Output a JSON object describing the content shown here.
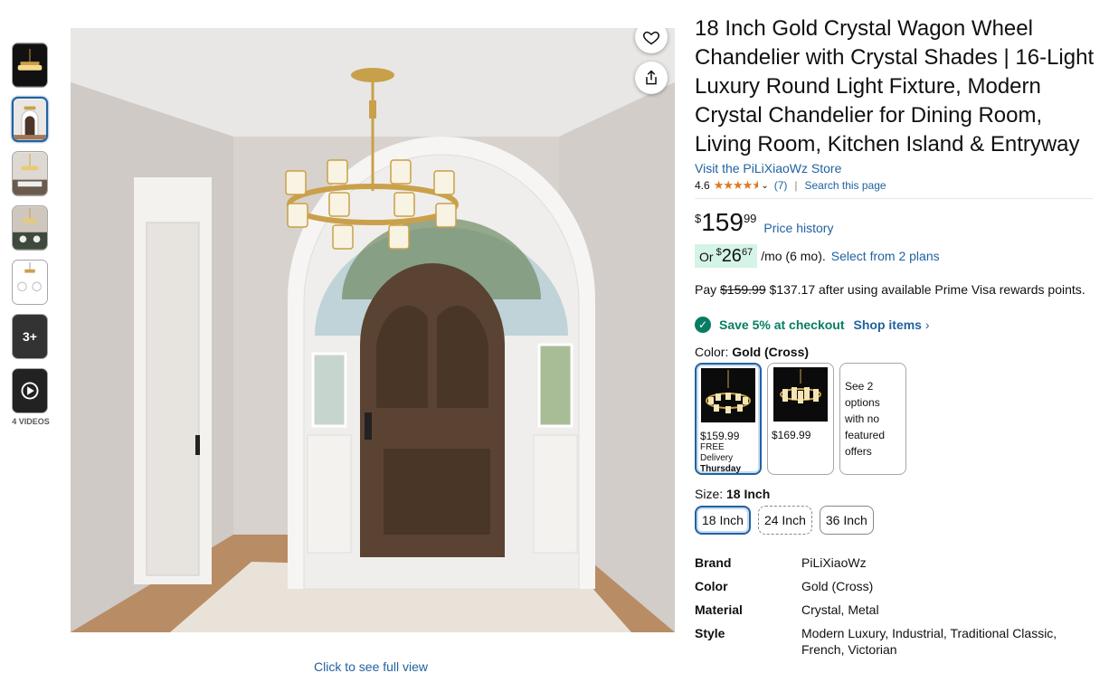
{
  "thumbnails": [
    {
      "name": "thumb-1",
      "selected": false
    },
    {
      "name": "thumb-2",
      "selected": true
    },
    {
      "name": "thumb-3",
      "selected": false
    },
    {
      "name": "thumb-4",
      "selected": false
    },
    {
      "name": "thumb-5",
      "selected": false
    }
  ],
  "more_thumbs_label": "3+",
  "videos_label": "4 VIDEOS",
  "main_image": {
    "icons": [
      "heart-icon",
      "share-icon"
    ],
    "full_view_label": "Click to see full view"
  },
  "product": {
    "title": "18 Inch Gold Crystal Wagon Wheel Chandelier with Crystal Shades | 16-Light Luxury Round Light Fixture, Modern Crystal Chandelier for Dining Room, Living Room, Kitchen Island & Entryway",
    "store_link": "Visit the PiLiXiaoWz Store",
    "rating": "4.6",
    "rating_count": "(7)",
    "search_page": "Search this page",
    "price": {
      "symbol": "$",
      "whole": "159",
      "fraction": "99"
    },
    "price_history": "Price history",
    "monthly": {
      "or": "Or",
      "symbol": "$",
      "whole": "26",
      "fraction": "67",
      "per": "/mo (6 mo).",
      "plans": "Select from 2 plans"
    },
    "pay": {
      "prefix": "Pay",
      "old": "$159.99",
      "rest": "$137.17 after using available Prime Visa rewards points."
    },
    "save": {
      "text": "Save 5% at checkout",
      "shop": "Shop items",
      "chevron": "›"
    },
    "color_label": "Color:",
    "color_value": "Gold (Cross)",
    "swatches": [
      {
        "price": "$159.99",
        "delivery": "FREE Delivery",
        "day": "Thursday",
        "selected": true
      },
      {
        "price": "$169.99",
        "selected": false
      },
      {
        "note": "See 2 options with no featured offers",
        "selected": false
      }
    ],
    "size_label": "Size:",
    "size_value": "18 Inch",
    "sizes": [
      "18 Inch",
      "24 Inch",
      "36 Inch"
    ],
    "specs": [
      {
        "key": "Brand",
        "value": "PiLiXiaoWz"
      },
      {
        "key": "Color",
        "value": "Gold (Cross)"
      },
      {
        "key": "Material",
        "value": "Crystal, Metal"
      },
      {
        "key": "Style",
        "value": "Modern Luxury, Industrial, Traditional Classic, French, Victorian"
      }
    ]
  },
  "colors": {
    "link": "#2162a1",
    "star": "#de7921",
    "green": "#067d62",
    "or_bg": "#d4f4e6"
  }
}
